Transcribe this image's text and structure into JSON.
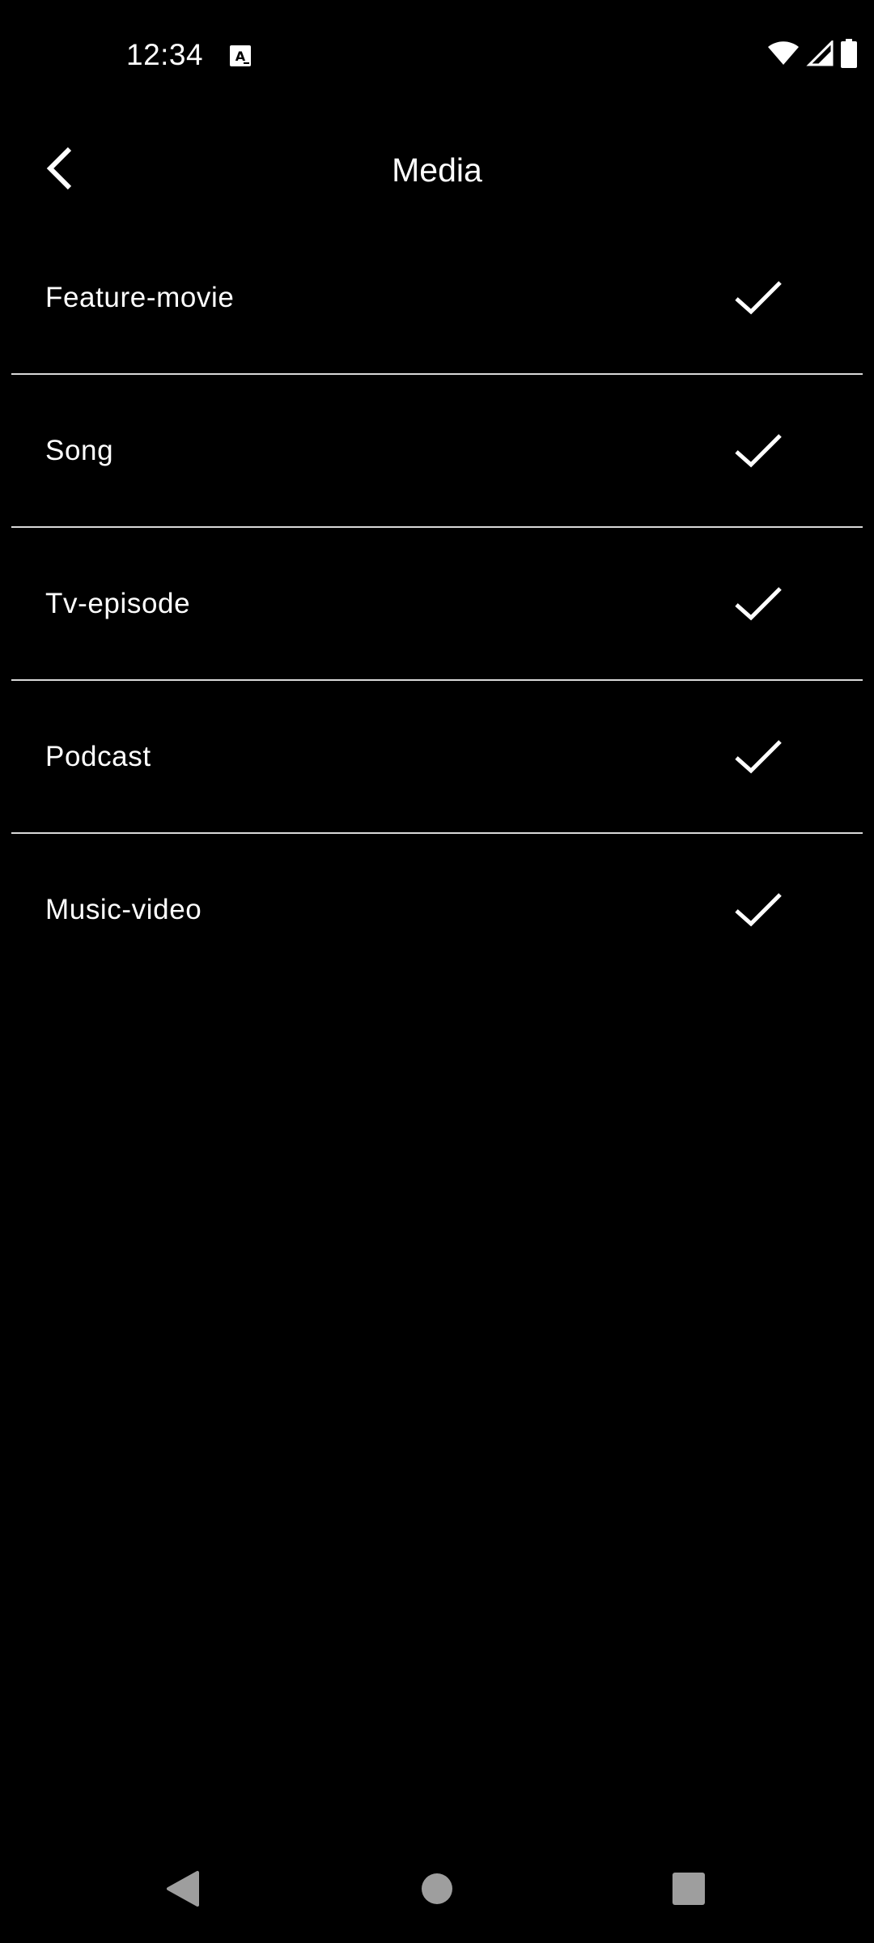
{
  "status_bar": {
    "time": "12:34",
    "notification_icon": "a-keyboard-icon",
    "right_icons": [
      "wifi-icon",
      "signal-icon",
      "battery-icon"
    ]
  },
  "app_bar": {
    "title": "Media",
    "back_icon": "chevron-left-icon"
  },
  "media_items": [
    {
      "label": "Feature-movie",
      "checked": true
    },
    {
      "label": "Song",
      "checked": true
    },
    {
      "label": "Tv-episode",
      "checked": true
    },
    {
      "label": "Podcast",
      "checked": true
    },
    {
      "label": "Music-video",
      "checked": true
    }
  ],
  "nav_bar": {
    "icons": [
      "back-triangle-icon",
      "home-circle-icon",
      "recents-square-icon"
    ]
  },
  "colors": {
    "background": "#000000",
    "text": "#ffffff",
    "divider": "#d9d9d9",
    "nav_icon": "#9e9e9e"
  }
}
